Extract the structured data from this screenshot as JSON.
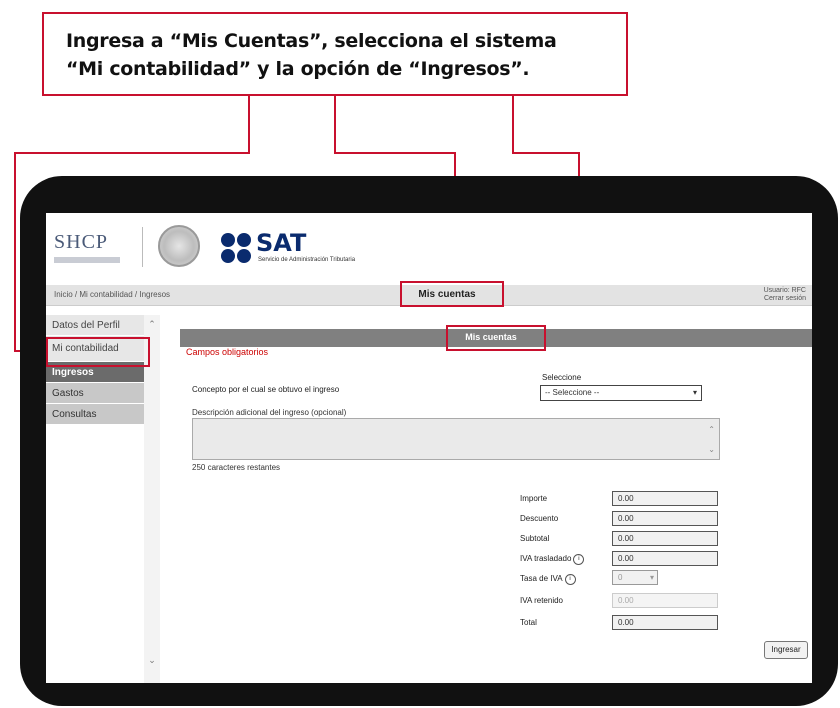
{
  "callout": {
    "line1": "Ingresa a “Mis Cuentas”, selecciona el sistema",
    "line2": "“Mi contabilidad” y la opción de “Ingresos”."
  },
  "header": {
    "shcp_logo": "SHCP",
    "sat_logo": "SAT",
    "sat_subtitle": "Servicio de Administración Tributaria"
  },
  "topbar": {
    "breadcrumb": "Inicio / Mi contabilidad / Ingresos",
    "nav_item": "Mis cuentas",
    "user_line1": "Usuario: RFC",
    "user_line2": "Cerrar sesión"
  },
  "sidebar": {
    "items": [
      {
        "label": "Datos del Perfil"
      },
      {
        "label": "Mi contabilidad"
      },
      {
        "label": "Ingresos"
      },
      {
        "label": "Gastos"
      },
      {
        "label": "Consultas"
      }
    ]
  },
  "panel": {
    "title": "Mis cuentas",
    "required_note": "Campos obligatorios"
  },
  "form": {
    "concept_label": "Concepto por el cual se obtuvo el ingreso",
    "select_label": "Seleccione",
    "select_value": "-- Seleccione --",
    "description_label": "Descripción adicional del ingreso (opcional)",
    "counter": "250 caracteres restantes",
    "fields": [
      {
        "label": "Importe",
        "value": "0.00"
      },
      {
        "label": "Descuento",
        "value": "0.00"
      },
      {
        "label": "Subtotal",
        "value": "0.00"
      },
      {
        "label": "IVA trasladado",
        "value": "0.00"
      },
      {
        "label": "Tasa de IVA",
        "value": "0"
      },
      {
        "label": "IVA retenido",
        "value": "0.00"
      },
      {
        "label": "Total",
        "value": "0.00"
      }
    ],
    "submit_label": "Ingresar"
  }
}
